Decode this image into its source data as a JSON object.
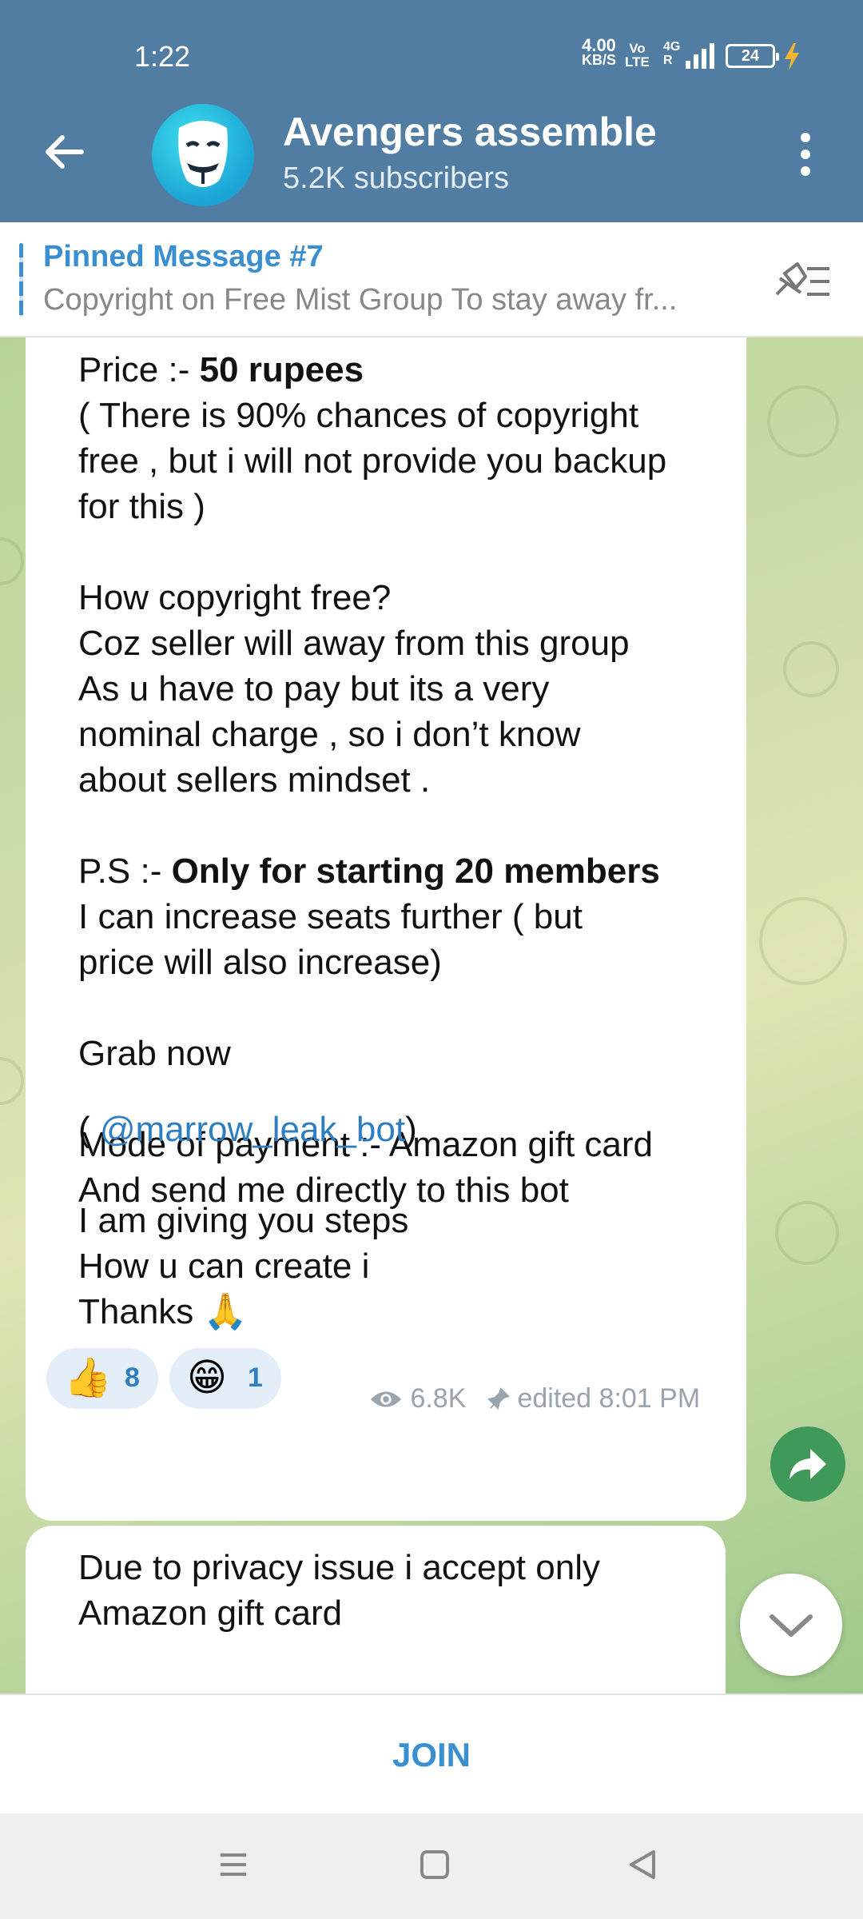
{
  "status_bar": {
    "time": "1:22",
    "net_speed_value": "4.00",
    "net_speed_unit": "KB/S",
    "volte_top": "Vo",
    "volte_bottom": "LTE",
    "network": "4G",
    "network_sub": "R",
    "battery": "24"
  },
  "header": {
    "title": "Avengers assemble",
    "subtitle": "5.2K subscribers"
  },
  "pinned": {
    "title": "Pinned Message #7",
    "text": "Copyright on Free Mist Group  To stay away fr..."
  },
  "message1": {
    "lines": [
      {
        "pre": "Price :- ",
        "bold": "50 rupees",
        "post": ""
      },
      {
        "pre": "( There is 90% chances of copyright",
        "bold": "",
        "post": ""
      },
      {
        "pre": "free , but i will not provide you backup",
        "bold": "",
        "post": ""
      },
      {
        "pre": "for this )",
        "bold": "",
        "post": ""
      },
      {
        "pre": "",
        "bold": "",
        "post": ""
      },
      {
        "pre": "How copyright free?",
        "bold": "",
        "post": ""
      },
      {
        "pre": "Coz seller will away from this group",
        "bold": "",
        "post": ""
      },
      {
        "pre": "As u have to pay but its a very",
        "bold": "",
        "post": ""
      },
      {
        "pre": "nominal charge , so i don’t know",
        "bold": "",
        "post": ""
      },
      {
        "pre": "about sellers mindset .",
        "bold": "",
        "post": ""
      },
      {
        "pre": "",
        "bold": "",
        "post": ""
      },
      {
        "pre": "P.S :- ",
        "bold": "Only for starting 20 members",
        "post": ""
      },
      {
        "pre": "I can increase seats further ( but",
        "bold": "",
        "post": ""
      },
      {
        "pre": "price will also increase)",
        "bold": "",
        "post": ""
      },
      {
        "pre": "",
        "bold": "",
        "post": ""
      },
      {
        "pre": "Grab now",
        "bold": "",
        "post": ""
      },
      {
        "pre": "",
        "bold": "",
        "post": ""
      },
      {
        "pre": "Mode of payment :- Amazon gift card",
        "bold": "",
        "post": ""
      },
      {
        "pre": "And send me directly to this bot",
        "bold": "",
        "post": ""
      }
    ],
    "link_prefix": "( ",
    "link": "@marrow_leak_bot",
    "link_suffix": ")",
    "tail_lines": [
      "I am giving you steps",
      "How u can create i",
      "Thanks 🙏"
    ],
    "reactions": [
      {
        "emoji": "👍",
        "count": "8"
      },
      {
        "emoji": "😁",
        "count": "1"
      }
    ],
    "views": "6.8K",
    "edited_time": "edited 8:01 PM"
  },
  "message2": {
    "lines": [
      "Due to privacy issue i accept only",
      "Amazon gift card"
    ]
  },
  "join_label": "JOIN"
}
